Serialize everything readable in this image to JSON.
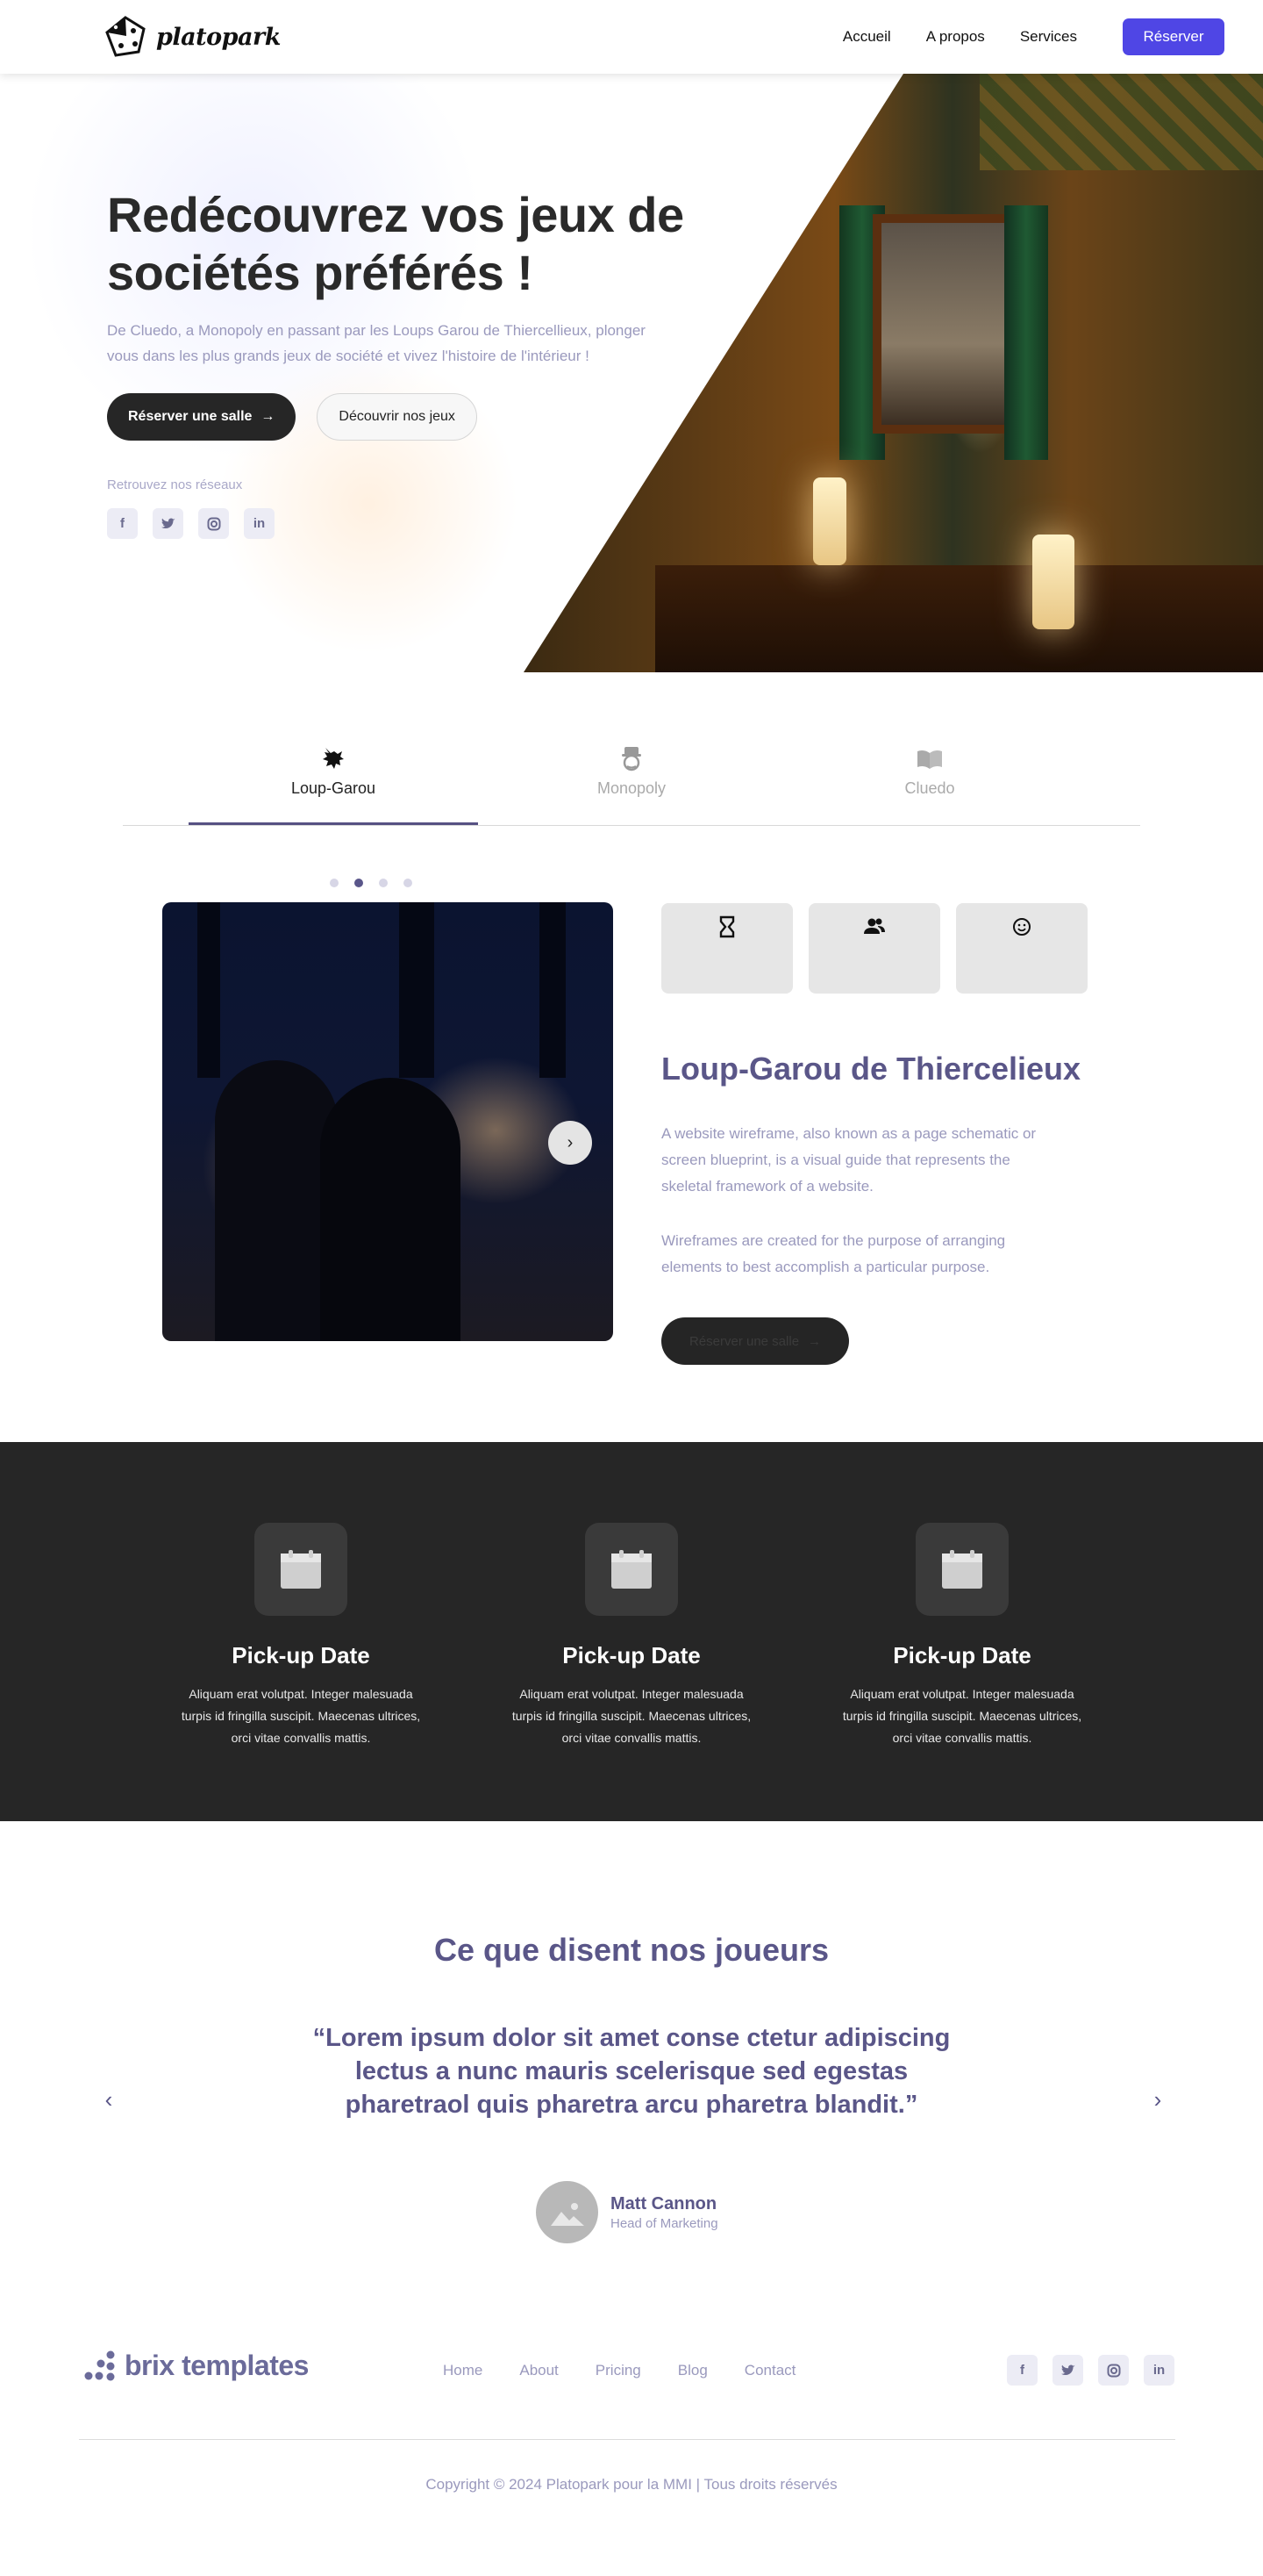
{
  "nav": {
    "logo_text": "platopark",
    "links": [
      "Accueil",
      "A propos",
      "Services"
    ],
    "cta": "Réserver"
  },
  "hero": {
    "title": "Redécouvrez vos jeux de sociétés préférés !",
    "description": "De Cluedo, a Monopoly en passant par les Loups Garou de Thiercellieux, plonger vous dans les plus grands jeux de société et vivez l'histoire de l'intérieur !",
    "primary_button": "Réserver une salle",
    "secondary_button": "Découvrir nos jeux",
    "social_label": "Retrouvez nos réseaux",
    "social_icons": [
      "facebook-icon",
      "twitter-icon",
      "instagram-icon",
      "linkedin-icon"
    ]
  },
  "tabs": [
    {
      "label": "Loup-Garou",
      "icon": "werewolf-icon",
      "active": true
    },
    {
      "label": "Monopoly",
      "icon": "monopoly-man-icon",
      "active": false
    },
    {
      "label": "Cluedo",
      "icon": "open-book-icon",
      "active": false
    }
  ],
  "feature": {
    "title": "Loup-Garou de Thiercelieux",
    "paragraph_1": "A website wireframe, also known as a page schematic or screen blueprint, is a visual guide that represents the skeletal framework of a website.",
    "paragraph_2": "Wireframes are created for the purpose of arranging elements to best accomplish a particular purpose.",
    "button": "Réserver une salle",
    "stat_icons": [
      "hourglass-icon",
      "users-icon",
      "smiley-icon"
    ],
    "dots_total": 4,
    "dots_active": 2
  },
  "services": [
    {
      "title": "Pick-up Date",
      "text": "Aliquam erat volutpat. Integer malesuada turpis id fringilla suscipit. Maecenas ultrices, orci vitae convallis mattis."
    },
    {
      "title": "Pick-up Date",
      "text": "Aliquam erat volutpat. Integer malesuada turpis id fringilla suscipit. Maecenas ultrices, orci vitae convallis mattis."
    },
    {
      "title": "Pick-up Date",
      "text": "Aliquam erat volutpat. Integer malesuada turpis id fringilla suscipit. Maecenas ultrices, orci vitae convallis mattis."
    }
  ],
  "testimonial": {
    "title": "Ce que disent nos joueurs",
    "quote": "“Lorem ipsum dolor sit amet conse ctetur adipiscing lectus a nunc mauris scelerisque sed egestas pharetraol quis pharetra arcu pharetra blandit.”",
    "author_name": "Matt Cannon",
    "author_role": "Head of Marketing"
  },
  "footer": {
    "logo_text": "brix templates",
    "links": [
      "Home",
      "About",
      "Pricing",
      "Blog",
      "Contact"
    ],
    "copyright": "Copyright © 2024 Platopark pour la MMI | Tous droits réservés"
  },
  "colors": {
    "accent": "#4f46e5",
    "heading_purple": "#5a5688",
    "muted_text": "#9a99bd",
    "dark_bg": "#262626"
  }
}
